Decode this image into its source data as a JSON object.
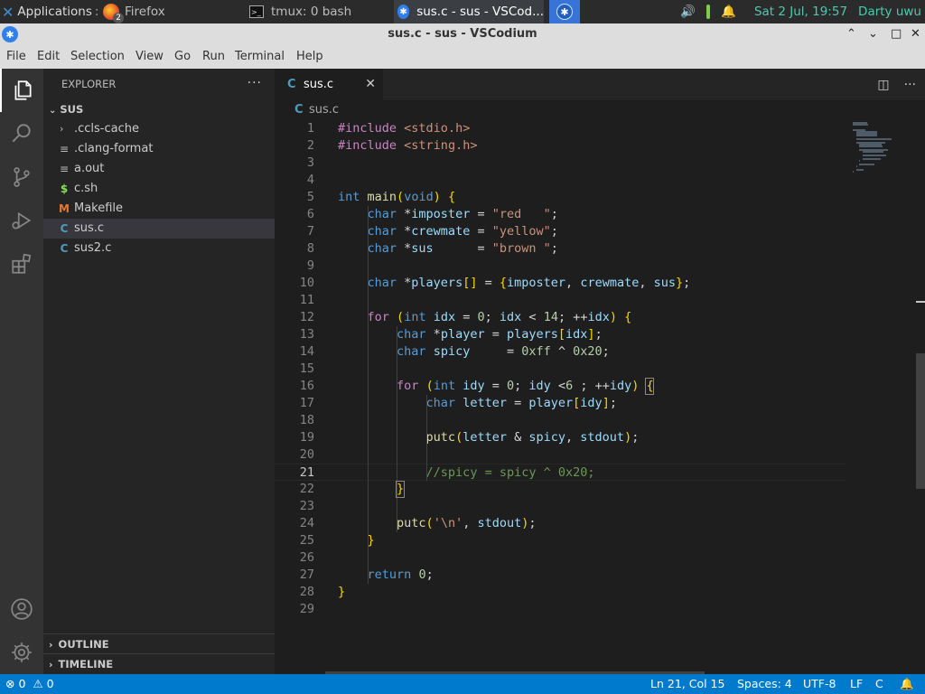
{
  "taskbar": {
    "applications_label": "Applications",
    "applications_suffix": ":",
    "firefox_label": "Firefox",
    "firefox_count": "2",
    "tmux_label": "tmux: 0 bash",
    "vscodium_label": "sus.c - sus - VSCod...",
    "datetime": "Sat  2 Jul, 19:57",
    "user": "Darty uwu"
  },
  "window": {
    "title": "sus.c - sus - VSCodium"
  },
  "menu": {
    "file": "File",
    "edit": "Edit",
    "selection": "Selection",
    "view": "View",
    "go": "Go",
    "run": "Run",
    "terminal": "Terminal",
    "help": "Help"
  },
  "sidebar": {
    "title": "EXPLORER",
    "more": "···",
    "root": "SUS",
    "items": [
      {
        "label": ".ccls-cache",
        "icon": "›"
      },
      {
        "label": ".clang-format",
        "icon": "≡"
      },
      {
        "label": "a.out",
        "icon": "≡"
      },
      {
        "label": "c.sh",
        "icon": "$"
      },
      {
        "label": "Makefile",
        "icon": "M"
      },
      {
        "label": "sus.c",
        "icon": "C"
      },
      {
        "label": "sus2.c",
        "icon": "C"
      }
    ],
    "outline": "OUTLINE",
    "timeline": "TIMELINE"
  },
  "editor": {
    "tab_label": "sus.c",
    "tab_icon": "C",
    "breadcrumb_icon": "C",
    "breadcrumb": "sus.c",
    "current_line": 21
  },
  "code": [
    "#include <stdio.h>",
    "#include <string.h>",
    "",
    "",
    "int main(void) {",
    "    char *imposter = \"red   \";",
    "    char *crewmate = \"yellow\";",
    "    char *sus      = \"brown \";",
    "",
    "    char *players[] = {imposter, crewmate, sus};",
    "",
    "    for (int idx = 0; idx < 14; ++idx) {",
    "        char *player = players[idx];",
    "        char spicy     = 0xff ^ 0x20;",
    "",
    "        for (int idy = 0; idy <6 ; ++idy) {",
    "            char letter = player[idy];",
    "",
    "            putc(letter & spicy, stdout);",
    "",
    "            //spicy = spicy ^ 0x20;",
    "        }",
    "",
    "        putc('\\n', stdout);",
    "    }",
    "",
    "    return 0;",
    "}",
    ""
  ],
  "statusbar": {
    "errors": "0",
    "warnings": "0",
    "position": "Ln 21, Col 15",
    "spaces": "Spaces: 4",
    "encoding": "UTF-8",
    "eol": "LF",
    "language": "C"
  }
}
